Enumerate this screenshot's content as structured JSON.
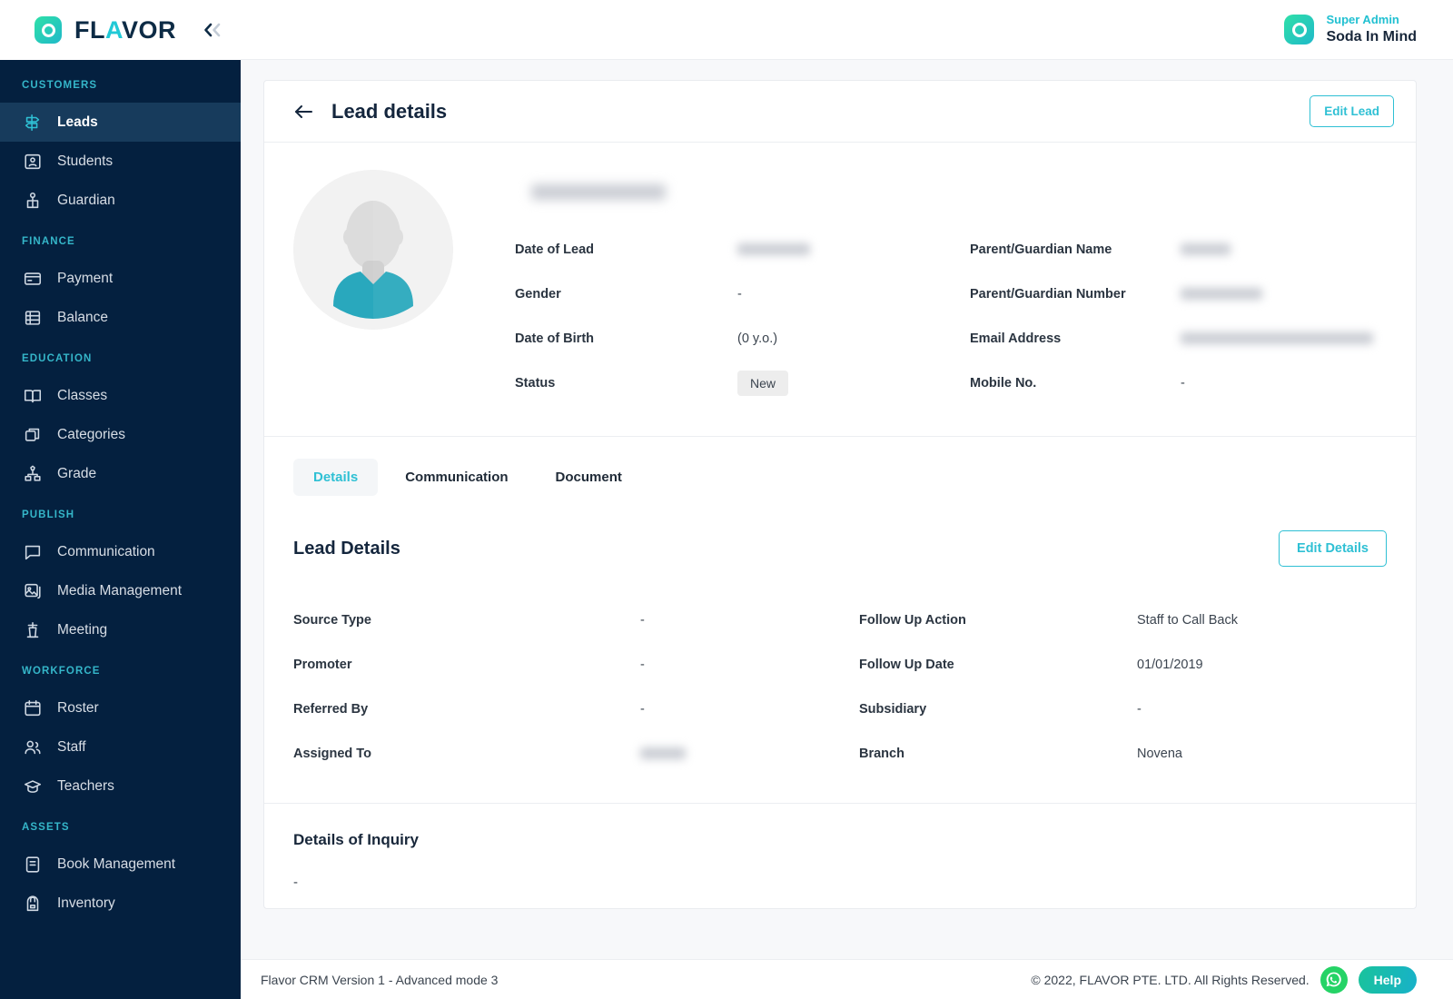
{
  "brand": {
    "name_prefix": "FL",
    "name_accent": "A",
    "name_suffix": "VOR",
    "collapse_icon": "double-chevron-left-icon"
  },
  "topbar": {
    "user_role": "Super Admin",
    "user_name": "Soda In Mind"
  },
  "sidebar": {
    "groups": [
      {
        "label": "CUSTOMERS",
        "items": [
          {
            "label": "Leads",
            "icon": "signpost-icon",
            "active": true
          },
          {
            "label": "Students",
            "icon": "id-card-icon",
            "active": false
          },
          {
            "label": "Guardian",
            "icon": "guardian-icon",
            "active": false
          }
        ]
      },
      {
        "label": "FINANCE",
        "items": [
          {
            "label": "Payment",
            "icon": "credit-card-icon",
            "active": false
          },
          {
            "label": "Balance",
            "icon": "coins-stack-icon",
            "active": false
          }
        ]
      },
      {
        "label": "EDUCATION",
        "items": [
          {
            "label": "Classes",
            "icon": "open-book-icon",
            "active": false
          },
          {
            "label": "Categories",
            "icon": "boxes-icon",
            "active": false
          },
          {
            "label": "Grade",
            "icon": "hierarchy-icon",
            "active": false
          }
        ]
      },
      {
        "label": "PUBLISH",
        "items": [
          {
            "label": "Communication",
            "icon": "chat-bubble-icon",
            "active": false
          },
          {
            "label": "Media Management",
            "icon": "image-stack-icon",
            "active": false
          },
          {
            "label": "Meeting",
            "icon": "podium-icon",
            "active": false
          }
        ]
      },
      {
        "label": "WORKFORCE",
        "items": [
          {
            "label": "Roster",
            "icon": "calendar-icon",
            "active": false
          },
          {
            "label": "Staff",
            "icon": "people-icon",
            "active": false
          },
          {
            "label": "Teachers",
            "icon": "graduation-cap-icon",
            "active": false
          }
        ]
      },
      {
        "label": "ASSETS",
        "items": [
          {
            "label": "Book Management",
            "icon": "book-icon",
            "active": false
          },
          {
            "label": "Inventory",
            "icon": "backpack-icon",
            "active": false
          }
        ]
      }
    ]
  },
  "lead_page": {
    "title": "Lead details",
    "back_icon": "arrow-left-icon",
    "edit_lead_label": "Edit Lead",
    "avatar": "default-person-avatar",
    "lead_name": "",
    "profile_fields_left": [
      {
        "label": "Date of Lead",
        "value": "",
        "redacted": true,
        "redact_width": 80
      },
      {
        "label": "Gender",
        "value": "-",
        "redacted": false
      },
      {
        "label": "Date of Birth",
        "value": "(0 y.o.)",
        "redacted": false
      },
      {
        "label": "Status",
        "value": "New",
        "badge": true
      }
    ],
    "profile_fields_right": [
      {
        "label": "Parent/Guardian Name",
        "value": "",
        "redacted": true,
        "redact_width": 55
      },
      {
        "label": "Parent/Guardian Number",
        "value": "",
        "redacted": true,
        "redact_width": 90
      },
      {
        "label": "Email Address",
        "value": "",
        "redacted": true,
        "redact_width": 212
      },
      {
        "label": "Mobile No.",
        "value": "-",
        "redacted": false
      }
    ]
  },
  "tabs": [
    {
      "label": "Details",
      "active": true
    },
    {
      "label": "Communication",
      "active": false
    },
    {
      "label": "Document",
      "active": false
    }
  ],
  "lead_details": {
    "title": "Lead Details",
    "edit_details_label": "Edit Details",
    "left": [
      {
        "label": "Source Type",
        "value": "-",
        "redacted": false
      },
      {
        "label": "Promoter",
        "value": "-",
        "redacted": false
      },
      {
        "label": "Referred By",
        "value": "-",
        "redacted": false
      },
      {
        "label": "Assigned To",
        "value": "",
        "redacted": true,
        "redact_width": 50
      }
    ],
    "right": [
      {
        "label": "Follow Up Action",
        "value": "Staff to Call Back",
        "redacted": false
      },
      {
        "label": "Follow Up Date",
        "value": "01/01/2019",
        "redacted": false
      },
      {
        "label": "Subsidiary",
        "value": "-",
        "redacted": false
      },
      {
        "label": "Branch",
        "value": "Novena",
        "redacted": false
      }
    ]
  },
  "inquiry": {
    "title": "Details of Inquiry",
    "value": "-"
  },
  "footer": {
    "version": "Flavor CRM Version 1 - Advanced mode 3",
    "copyright": "© 2022, FLAVOR PTE. LTD. All Rights Reserved.",
    "whatsapp_icon": "whatsapp-icon",
    "help_label": "Help"
  },
  "colors": {
    "accent_cyan": "#2fc0d4",
    "sidebar_bg": "#04203f",
    "sidebar_active": "#173b5c",
    "group_label": "#35b6c9",
    "title_navy": "#14263d",
    "whatsapp_green": "#25d366"
  }
}
